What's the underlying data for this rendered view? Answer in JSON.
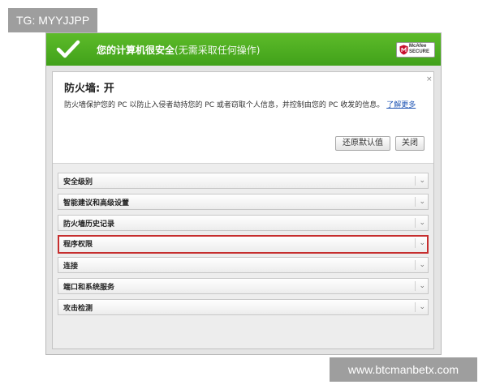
{
  "watermarks": {
    "top": "TG: MYYJJPP",
    "bottom": "www.btcmanbetx.com"
  },
  "header": {
    "status_title": "您的计算机很安全",
    "status_sub": "(无需采取任何操作)",
    "check_icon": "checkmark-icon",
    "logo": {
      "line1": "McAfee",
      "line2": "SECURE",
      "icon": "mcafee-shield-logo"
    },
    "colors": {
      "green_top": "#5dbb2a",
      "green_bottom": "#41a11a"
    }
  },
  "firewall": {
    "title": "防火墙: 开",
    "description": "防火墙保护您的 PC 以防止入侵者劫持您的 PC 或者窃取个人信息，并控制由您的 PC 收发的信息。",
    "learn_more": "了解更多",
    "close_symbol": "×",
    "buttons": {
      "restore": "还原默认值",
      "close": "关闭"
    }
  },
  "sections": [
    {
      "label": "安全级别",
      "selected": false
    },
    {
      "label": "智能建议和高级设置",
      "selected": false
    },
    {
      "label": "防火墙历史记录",
      "selected": false
    },
    {
      "label": "程序权限",
      "selected": true
    },
    {
      "label": "连接",
      "selected": false
    },
    {
      "label": "端口和系统服务",
      "selected": false
    },
    {
      "label": "攻击检测",
      "selected": false
    }
  ],
  "section_chevron": "chevron-down-icon",
  "highlight_color": "#c62e2e"
}
